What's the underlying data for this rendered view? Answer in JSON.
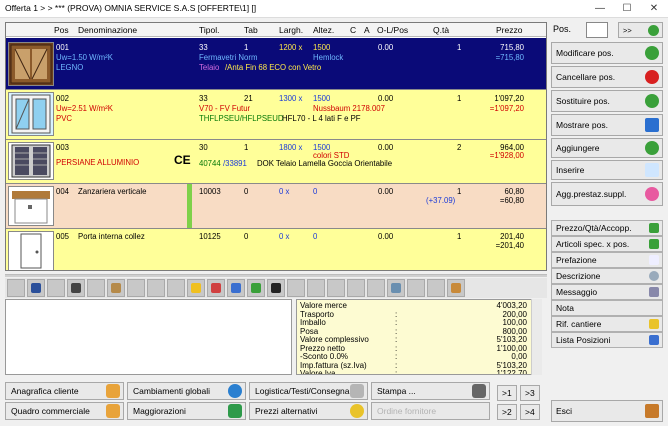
{
  "window": {
    "title": "Offerta 1 >  > *** (PROVA) OMNIA SERVICE S.A.S  [OFFERTE\\1] []",
    "min": "—",
    "max": "☐",
    "close": "✕"
  },
  "colors": {
    "row_selected": "#0a0a78",
    "row_yellow": "#ffff99",
    "row_peach": "#f8dcc4",
    "summary_bg": "#fdfbd2",
    "accent_green": "#7fd14a"
  },
  "columns": {
    "pos": "Pos",
    "den": "Denominazione",
    "tipol": "Tipol.",
    "tab": "Tab",
    "largh": "Largh.",
    "altez": "Altez.",
    "c": "C",
    "a": "A",
    "olpos": "O-L/Pos",
    "qta": "Q.tà",
    "prezzo": "Prezzo"
  },
  "rows": [
    {
      "pos": "001",
      "l2": "Uw=1.50 W/m²K",
      "l3": "LEGNO",
      "tipol": "33",
      "tab": "1",
      "largh": "1200 x",
      "altez": "1500",
      "olpos": "0.00",
      "qta": "1",
      "prezzo": "715,80",
      "prezzo2": "=715,80",
      "t2": "Fermavetri Norm",
      "t2b": "Hemlock",
      "t3a": "Telaio",
      "t3b": "/Anta Fin 68 ECO con Vetro"
    },
    {
      "pos": "002",
      "l2": "Uw=2.51 W/m²K",
      "l3": "PVC",
      "tipol": "33",
      "tab": "21",
      "largh": "1300 x",
      "altez": "1500",
      "olpos": "0.00",
      "qta": "1",
      "prezzo": "1'097,20",
      "prezzo2": "=1'097,20",
      "t2": "V70 - FV Futur",
      "t2b": "Nussbaum 2178.007",
      "t3a": "THFLPSEU/HFLPSEUD",
      "t3b": "HFL70 - L 4 lati F e PF"
    },
    {
      "pos": "003",
      "l2": "PERSIANE ALLUMINIO",
      "ce": "CE",
      "tipol": "30",
      "tab": "1",
      "largh": "1800 x",
      "altez": "1500",
      "olpos": "0.00",
      "qta": "2",
      "prezzo": "964,00",
      "prezzo2": "=1'928,00",
      "t2b": "colori STD",
      "t3a": "40744",
      "t3b": "/33891",
      "t3c": "DOK Telaio Lamella Goccia Orientabile"
    },
    {
      "pos": "004",
      "den": "Zanzariera verticale",
      "tipol": "10003",
      "tab": "0",
      "largh": "0 x",
      "altez": "0",
      "olpos": "0.00",
      "qta": "1",
      "qta2": "(+37.09)",
      "prezzo": "60,80",
      "prezzo2": "=60,80"
    },
    {
      "pos": "005",
      "den": "Porta interna collez",
      "tipol": "10125",
      "tab": "0",
      "largh": "0 x",
      "altez": "0",
      "olpos": "0.00",
      "qta": "1",
      "prezzo": "201,40",
      "prezzo2": "=201,40"
    }
  ],
  "toolbar_icons": [
    "blank-icon",
    "book-icon",
    "blank-icon",
    "speaker-icon",
    "blank-icon",
    "window-icon",
    "blank-icon",
    "blank-icon",
    "blank-icon",
    "smiley-icon",
    "no-entry-icon",
    "person-icon",
    "globe-icon",
    "brush-icon",
    "blank-icon",
    "blank-icon",
    "blank-icon",
    "blank-icon",
    "blank-icon",
    "calculator-icon",
    "blank-icon",
    "blank-icon",
    "arrow-icon"
  ],
  "summary": [
    {
      "label": "Valore merce",
      "colon": "",
      "value": "4'003,20"
    },
    {
      "label": "Trasporto",
      "colon": ":",
      "value": "200,00"
    },
    {
      "label": "Imballo",
      "colon": ":",
      "value": "100,00"
    },
    {
      "label": "Posa",
      "colon": ":",
      "value": "800,00"
    },
    {
      "label": "Valore complessivo",
      "colon": ":",
      "value": "5'103,20"
    },
    {
      "label": "Prezzo netto",
      "colon": ":",
      "value": "1'100,00"
    },
    {
      "label": "-Sconto 0.0%",
      "colon": ":",
      "value": "0,00"
    },
    {
      "label": "Imp.fattura (sz.Iva)",
      "colon": ":",
      "value": "5'103,20"
    },
    {
      "label": "Valore Iva",
      "colon": ":",
      "value": "1'122,70"
    }
  ],
  "bottom": {
    "anagrafica": "Anagrafica cliente",
    "quadro": "Quadro commerciale",
    "cambiamenti": "Cambiamenti globali",
    "maggiorazioni": "Maggiorazioni",
    "logistica": "Logistica/Testi/Consegna",
    "prezzi": "Prezzi alternativi",
    "stampa": "Stampa ...",
    "ordine": "Ordine fornitore",
    "n1": ">1",
    "n3": ">3",
    "n2": ">2",
    "n4": ">4"
  },
  "right": {
    "pos_label": "Pos.",
    "nav": ">>",
    "modifica": "Modificare pos.",
    "cancella": "Cancellare pos.",
    "sostituisci": "Sostituire pos.",
    "mostra": "Mostrare pos.",
    "aggiungi": "Aggiungere",
    "inserisci": "Inserire",
    "aggprest": "Agg.prestaz.suppl.",
    "prezzo": "Prezzo/Qtà/Accopp.",
    "articoli": "Articoli spec. x pos.",
    "prefazione": "Prefazione",
    "descrizione": "Descrizione",
    "messaggio": "Messaggio",
    "nota": "Nota",
    "rif": "Rif. cantiere",
    "lista": "Lista Posizioni",
    "esci": "Esci"
  }
}
